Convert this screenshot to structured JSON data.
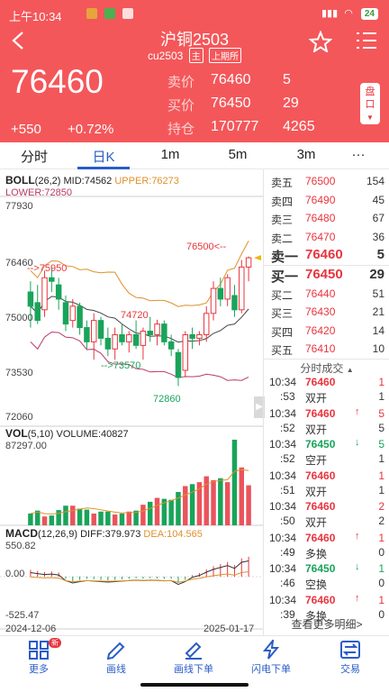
{
  "status_bar": {
    "time": "上午10:34",
    "battery": "24"
  },
  "header": {
    "title": "沪铜2503",
    "code": "cu2503",
    "tag_main": "主",
    "tag_exchange": "上期所"
  },
  "quote": {
    "price": "76460",
    "change": "+550",
    "change_pct": "+0.72%",
    "rows": [
      {
        "label": "卖价",
        "value": "76460",
        "vol": "5"
      },
      {
        "label": "买价",
        "value": "76450",
        "vol": "29"
      },
      {
        "label": "持仓",
        "value": "170777",
        "vol": "4265"
      }
    ],
    "pankou": "盘口"
  },
  "tabs": [
    "分时",
    "日K",
    "1m",
    "5m",
    "3m",
    "···"
  ],
  "boll": {
    "name": "BOLL",
    "params": "(26,2)",
    "mid": "MID:74562",
    "upper": "UPPER:76273",
    "lower": "LOWER:72850",
    "axis": [
      "77930",
      "76460",
      "75000",
      "73530",
      "72060"
    ],
    "annotations": {
      "a1": "76500<--",
      "a2": "-->75950",
      "a3": "74720",
      "a4": "-->73570",
      "a5": "72860"
    }
  },
  "vol": {
    "name": "VOL",
    "params": "(5,10)",
    "volume": "VOLUME:40827",
    "axis": "87297.00"
  },
  "macd": {
    "name": "MACD",
    "params": "(12,26,9)",
    "diff": "DIFF:379.973",
    "dea": "DEA:104.565",
    "axis": [
      "550.82",
      "0.00",
      "-525.47"
    ]
  },
  "dates": {
    "start": "2024-12-06",
    "end": "2025-01-17"
  },
  "chart_data": {
    "type": "candlestick",
    "candles": [
      [
        75500,
        75800,
        74500,
        75100
      ],
      [
        75200,
        75700,
        74600,
        74700
      ],
      [
        75000,
        76100,
        74800,
        75900
      ],
      [
        75900,
        76200,
        75500,
        75800
      ],
      [
        75700,
        75900,
        75000,
        75300
      ],
      [
        75200,
        75400,
        74400,
        74600
      ],
      [
        74700,
        75300,
        74500,
        75100
      ],
      [
        75100,
        75200,
        74300,
        74500
      ],
      [
        74500,
        74700,
        73900,
        74100
      ],
      [
        74100,
        74900,
        73600,
        74700
      ],
      [
        74700,
        74800,
        74000,
        74200
      ],
      [
        74200,
        74500,
        73700,
        73900
      ],
      [
        73900,
        74500,
        73600,
        74300
      ],
      [
        74300,
        74600,
        74000,
        74100
      ],
      [
        74100,
        74400,
        73800,
        74300
      ],
      [
        74300,
        74700,
        73900,
        74000
      ],
      [
        74000,
        74500,
        73600,
        74400
      ],
      [
        74400,
        74800,
        74100,
        74300
      ],
      [
        74300,
        74720,
        74000,
        74600
      ],
      [
        74600,
        74700,
        74000,
        74100
      ],
      [
        74100,
        74300,
        73700,
        73900
      ],
      [
        73800,
        73900,
        72860,
        73100
      ],
      [
        73300,
        74400,
        73100,
        74300
      ],
      [
        74300,
        74500,
        73900,
        74200
      ],
      [
        74200,
        74400,
        74000,
        74300
      ],
      [
        74300,
        75100,
        74100,
        74900
      ],
      [
        74900,
        75800,
        74700,
        75600
      ],
      [
        75600,
        75900,
        75100,
        75300
      ],
      [
        75300,
        76000,
        75100,
        75900
      ],
      [
        75400,
        75700,
        74800,
        75000
      ],
      [
        75000,
        76400,
        74900,
        76200
      ],
      [
        76200,
        76500,
        75800,
        76460
      ]
    ],
    "volume": [
      12000,
      15000,
      9000,
      10000,
      15500,
      20000,
      20000,
      17000,
      16000,
      12000,
      14000,
      14000,
      11000,
      12000,
      14000,
      15000,
      21000,
      24000,
      28000,
      27000,
      26000,
      34000,
      40000,
      42000,
      44000,
      50000,
      46000,
      48000,
      44000,
      87297,
      59000,
      40827
    ],
    "macd_hist": [
      130,
      110,
      90,
      100,
      80,
      -40,
      -90,
      -60,
      -40,
      -50,
      -60,
      -70,
      -60,
      -50,
      -40,
      -30,
      -40,
      -30,
      -35,
      -45,
      -40,
      -120,
      -60,
      30,
      70,
      140,
      200,
      240,
      280,
      220,
      350,
      380
    ]
  }
}
